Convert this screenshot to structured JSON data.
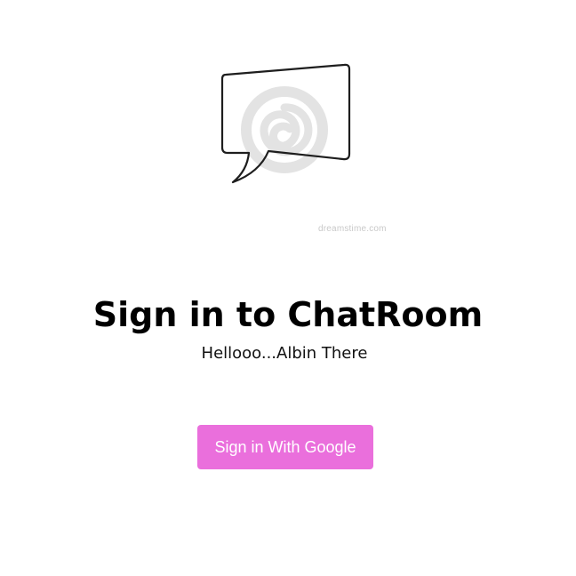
{
  "logo": {
    "icon": "chat-bubble-icon",
    "watermark": "dreamstime.com"
  },
  "auth": {
    "title": "Sign in to ChatRoom",
    "subtitle": "Hellooo...Albin There",
    "google_button_label": "Sign in With Google"
  },
  "colors": {
    "button_background": "#ea6fdc",
    "button_text": "#ffffff",
    "title_text": "#000000"
  }
}
